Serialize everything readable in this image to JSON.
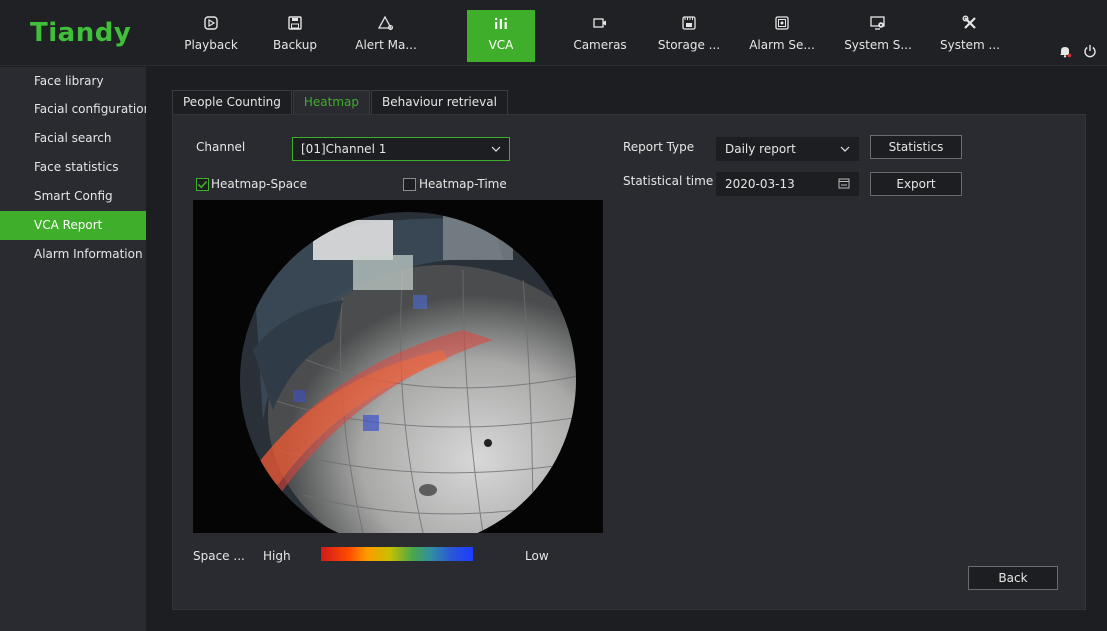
{
  "brand": {
    "logo_text": "Tiandy",
    "logo_color": "#3fbf3a",
    "accent": "#3fae2a"
  },
  "nav": [
    {
      "label": "Playback",
      "icon": "playback-icon"
    },
    {
      "label": "Backup",
      "icon": "save-icon"
    },
    {
      "label": "Alert Ma...",
      "icon": "alert-icon"
    },
    {
      "label": "VCA",
      "icon": "vca-icon",
      "active": true
    },
    {
      "label": "Cameras",
      "icon": "camera-icon"
    },
    {
      "label": "Storage ...",
      "icon": "storage-icon"
    },
    {
      "label": "Alarm Se...",
      "icon": "alarm-settings-icon"
    },
    {
      "label": "System S...",
      "icon": "system-settings-icon"
    },
    {
      "label": "System ...",
      "icon": "tools-icon"
    }
  ],
  "sidebar": {
    "items": [
      {
        "label": "Face library"
      },
      {
        "label": "Facial configuration"
      },
      {
        "label": "Facial search"
      },
      {
        "label": "Face statistics"
      },
      {
        "label": "Smart Config"
      },
      {
        "label": "VCA Report",
        "active": true
      },
      {
        "label": "Alarm Information"
      }
    ]
  },
  "tabs": [
    {
      "label": "People Counting"
    },
    {
      "label": "Heatmap",
      "active": true
    },
    {
      "label": "Behaviour retrieval"
    }
  ],
  "form": {
    "channel_label": "Channel",
    "channel_value": "[01]Channel 1",
    "heatmap_space_label": "Heatmap-Space",
    "heatmap_space_checked": true,
    "heatmap_time_label": "Heatmap-Time",
    "heatmap_time_checked": false,
    "report_type_label": "Report Type",
    "report_type_value": "Daily report",
    "statistics_button": "Statistics",
    "statistical_time_label": "Statistical time",
    "statistical_time_value": "2020-03-13",
    "export_button": "Export"
  },
  "legend": {
    "title": "Space ...",
    "high_label": "High",
    "low_label": "Low"
  },
  "back_button": "Back"
}
